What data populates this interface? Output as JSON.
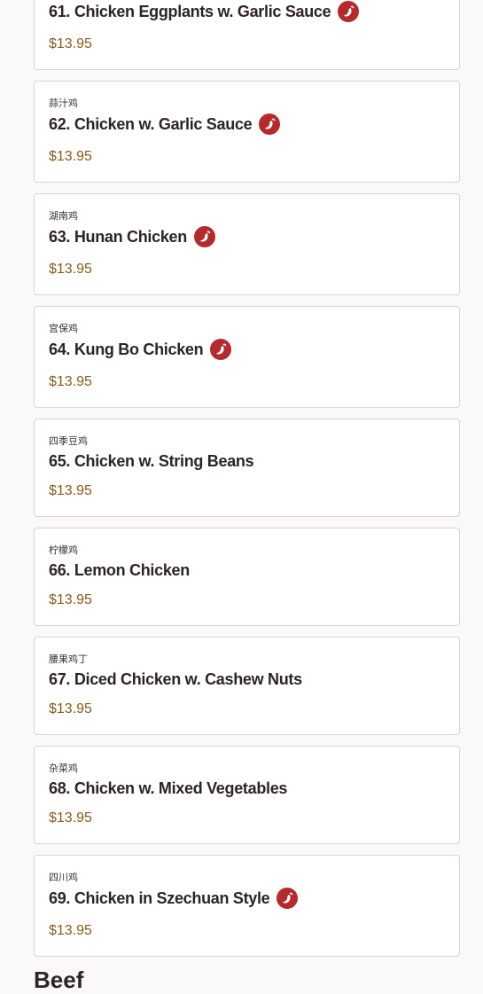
{
  "menu": {
    "items": [
      {
        "cn": "",
        "name": "61. Chicken Eggplants w. Garlic Sauce",
        "price": "$13.95",
        "spicy": true
      },
      {
        "cn": "蒜汁鸡",
        "name": "62. Chicken w. Garlic Sauce",
        "price": "$13.95",
        "spicy": true
      },
      {
        "cn": "湖南鸡",
        "name": "63. Hunan Chicken",
        "price": "$13.95",
        "spicy": true
      },
      {
        "cn": "宫保鸡",
        "name": "64. Kung Bo Chicken",
        "price": "$13.95",
        "spicy": true
      },
      {
        "cn": "四季豆鸡",
        "name": "65. Chicken w. String Beans",
        "price": "$13.95",
        "spicy": false
      },
      {
        "cn": "柠檬鸡",
        "name": "66. Lemon Chicken",
        "price": "$13.95",
        "spicy": false
      },
      {
        "cn": "腰果鸡丁",
        "name": "67. Diced Chicken w. Cashew Nuts",
        "price": "$13.95",
        "spicy": false
      },
      {
        "cn": "杂菜鸡",
        "name": "68. Chicken w. Mixed Vegetables",
        "price": "$13.95",
        "spicy": false
      },
      {
        "cn": "四川鸡",
        "name": "69. Chicken in Szechuan Style",
        "price": "$13.95",
        "spicy": true
      }
    ],
    "next_section": "Beef"
  },
  "colors": {
    "spicy_icon": "#b52a2a",
    "price": "#8a5a1a",
    "background": "#faf9f7"
  },
  "icons": {
    "spicy": "chili-pepper-icon"
  }
}
